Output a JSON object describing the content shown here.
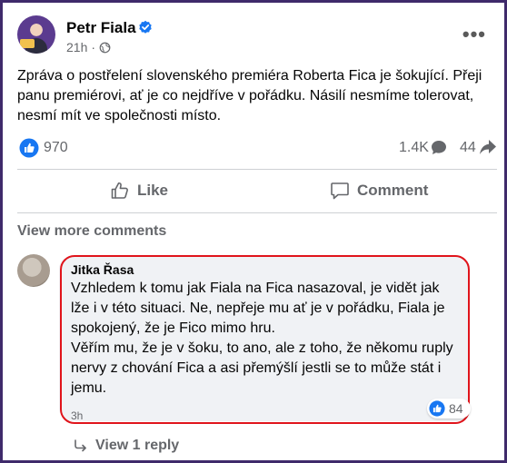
{
  "post": {
    "author": "Petr Fiala",
    "time": "21h",
    "text": "Zpráva o postřelení slovenského premiéra Roberta Fica je šokující. Přeji panu premiérovi, ať je co nejdříve v pořádku. Násilí nesmíme tolerovat, nesmí mít ve společnosti místo.",
    "more_label": "•••"
  },
  "stats": {
    "likes": "970",
    "comments": "1.4K",
    "shares": "44"
  },
  "actions": {
    "like_label": "Like",
    "comment_label": "Comment"
  },
  "comments_section": {
    "view_more_label": "View more comments",
    "comment": {
      "author": "Jitka Řasa",
      "paragraphs": [
        "Vzhledem k tomu jak Fiala na Fica nasazoval, je vidět jak lže i v této situaci. Ne, nepřeje mu ať je v pořádku, Fiala je spokojený, že je Fico mimo hru.",
        "Věřím mu, že je v šoku, to ano, ale z toho, že někomu ruply nervy z chování Fica a asi přemýšlí jestli se to může stát i jemu."
      ],
      "reaction_count": "84",
      "time": "3h"
    },
    "view_reply_label": "View 1 reply"
  },
  "colors": {
    "frame": "#3f2a6b",
    "like_blue": "#1877f2",
    "highlight_red": "#e0141b",
    "muted_text": "#65676b"
  },
  "icons": [
    "verified-badge-icon",
    "globe-icon",
    "more-options-icon",
    "like-reaction-icon",
    "comment-bubble-icon",
    "share-arrow-icon",
    "thumbs-up-icon",
    "comment-icon",
    "reply-arrow-icon"
  ]
}
